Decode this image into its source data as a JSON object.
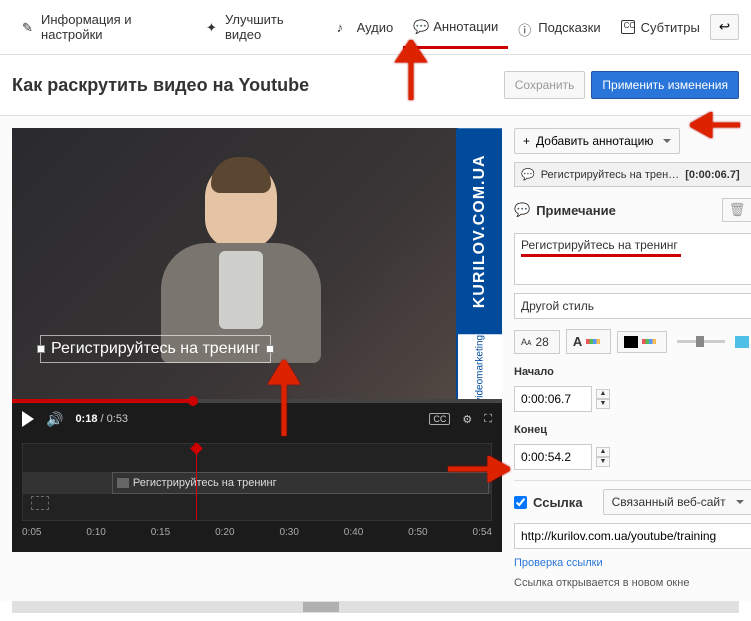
{
  "tabs": {
    "info": "Информация и настройки",
    "enhance": "Улучшить видео",
    "audio": "Аудио",
    "annotations": "Аннотации",
    "tips": "Подсказки",
    "subs": "Субтитры"
  },
  "video_title": "Как раскрутить видео на Youtube",
  "header": {
    "save": "Сохранить",
    "apply": "Применить изменения"
  },
  "banner": {
    "url": "KURILOV.COM.UA",
    "tag": "videomarketing"
  },
  "overlay_text": "Регистрируйтесь на тренинг",
  "player": {
    "current": "0:18",
    "total": "0:53"
  },
  "timeline": {
    "clip_label": "Регистрируйтесь на тренинг",
    "marks": [
      "0:05",
      "0:10",
      "0:15",
      "0:20",
      "0:30",
      "0:40",
      "0:50",
      "0:54"
    ]
  },
  "panel": {
    "add": "Добавить аннотацию",
    "list_item": "Регистрируйтесь на трен…",
    "list_time": "[0:00:06.7]",
    "section": "Примечание",
    "note_text": "Регистрируйтесь на тренинг",
    "style": "Другой стиль",
    "font_size": "28",
    "start_label": "Начало",
    "start": "0:00:06.7",
    "end_label": "Конец",
    "end": "0:00:54.2",
    "link_label": "Ссылка",
    "link_type": "Связанный веб-сайт",
    "url": "http://kurilov.com.ua/youtube/training",
    "check_link": "Проверка ссылки",
    "link_note": "Ссылка открывается в новом окне"
  }
}
